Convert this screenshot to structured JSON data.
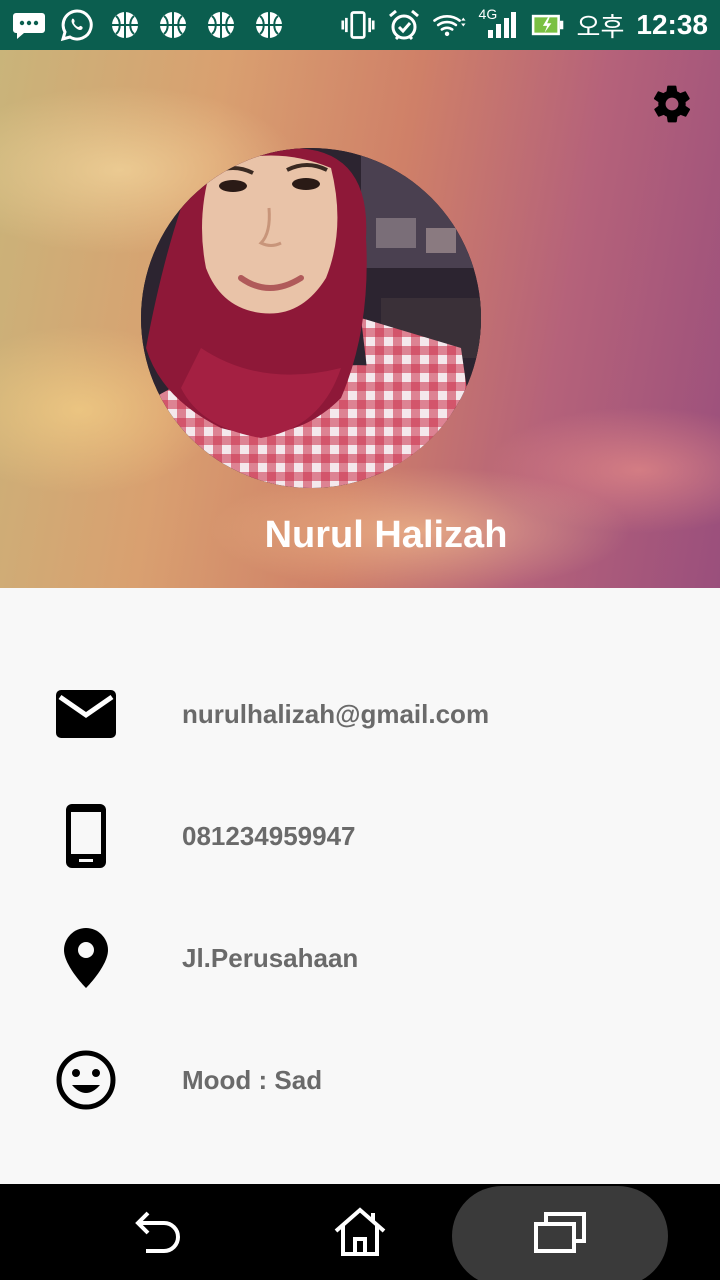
{
  "status_bar": {
    "ampm": "오후",
    "time": "12:38",
    "network_label": "4G",
    "icons": [
      "messenger-icon",
      "whatsapp-icon",
      "basketball-icon",
      "basketball-icon",
      "basketball-icon",
      "basketball-icon",
      "vibrate-icon",
      "alarm-icon",
      "wifi-icon",
      "signal-icon",
      "battery-charging-icon"
    ],
    "bg_color": "#0b5e4f"
  },
  "profile": {
    "name": "Nurul Halizah",
    "settings_icon": "gear-icon"
  },
  "info": {
    "email": "nurulhalizah@gmail.com",
    "phone": "081234959947",
    "address": "Jl.Perusahaan",
    "mood": "Mood : Sad"
  },
  "nav_bar": {
    "icons": [
      "back-icon",
      "home-icon",
      "recent-apps-icon"
    ]
  }
}
